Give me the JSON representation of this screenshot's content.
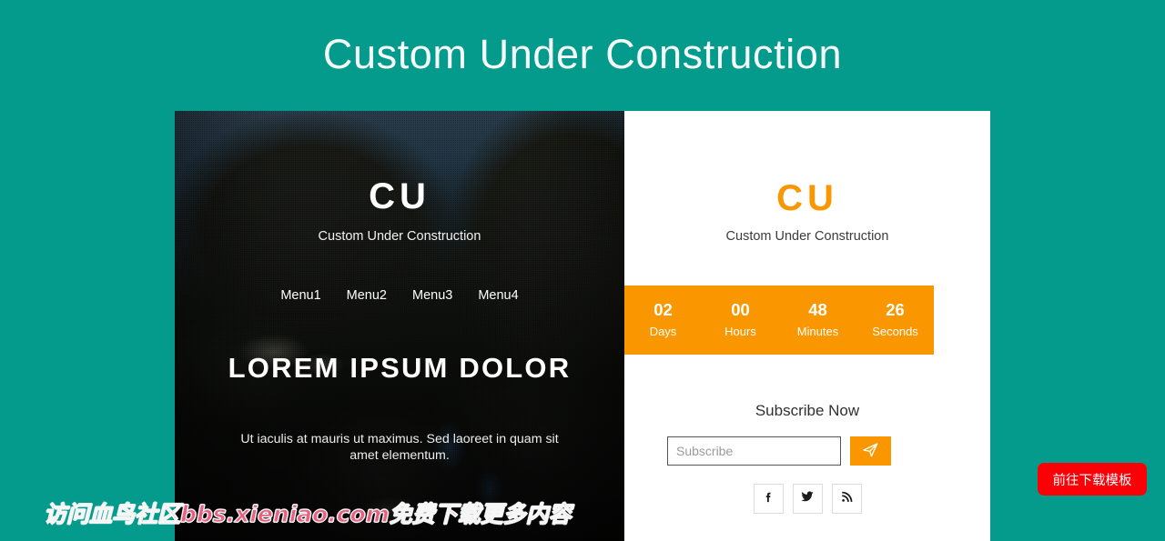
{
  "page": {
    "title": "Custom Under Construction",
    "background_color": "#059b8c"
  },
  "left_panel": {
    "logo": "CU",
    "logo_subtitle": "Custom Under Construction",
    "menu": [
      {
        "label": "Menu1"
      },
      {
        "label": "Menu2"
      },
      {
        "label": "Menu3"
      },
      {
        "label": "Menu4"
      }
    ],
    "hero_title": "LOREM IPSUM DOLOR",
    "hero_text": "Ut iaculis at mauris ut maximus. Sed laoreet in quam sit amet elementum."
  },
  "right_panel": {
    "logo": "CU",
    "logo_color": "#fa9600",
    "logo_subtitle": "Custom Under Construction",
    "countdown": {
      "background_color": "#fa9600",
      "units": [
        {
          "value": "02",
          "label": "Days"
        },
        {
          "value": "00",
          "label": "Hours"
        },
        {
          "value": "48",
          "label": "Minutes"
        },
        {
          "value": "26",
          "label": "Seconds"
        }
      ]
    },
    "subscribe": {
      "title": "Subscribe Now",
      "input_value": "",
      "input_placeholder": "Subscribe",
      "submit_icon": "paper-plane-icon",
      "submit_color": "#fa9600"
    },
    "socials": [
      {
        "name": "facebook-icon",
        "glyph": "f"
      },
      {
        "name": "twitter-icon",
        "glyph": "twitter"
      },
      {
        "name": "rss-icon",
        "glyph": "rss"
      }
    ]
  },
  "watermark": {
    "text": "访问血鸟社区bbs.xieniao.com免费下载更多内容",
    "color": "#e8607f"
  },
  "cta": {
    "label": "前往下载模板",
    "color": "#fb0007"
  }
}
